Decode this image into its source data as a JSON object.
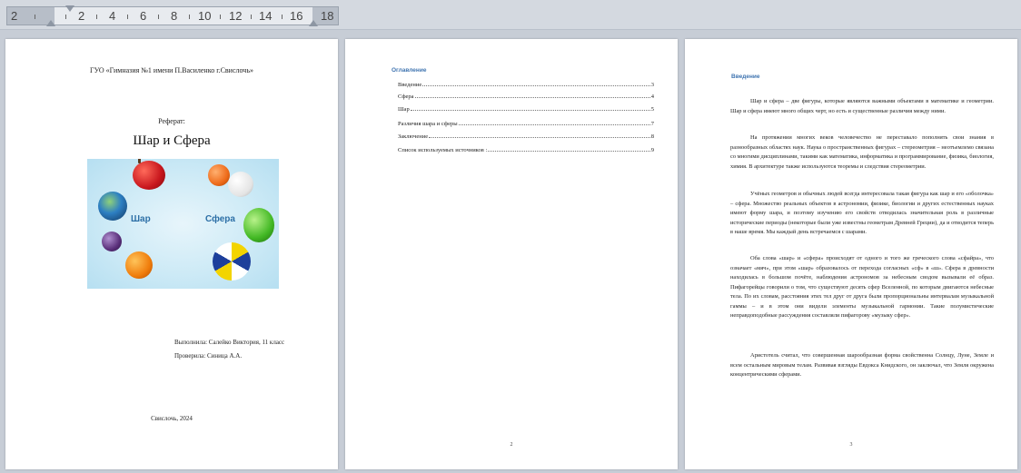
{
  "ruler": {
    "labels": [
      "2",
      "2",
      "4",
      "6",
      "8",
      "10",
      "12",
      "14",
      "16",
      "18"
    ]
  },
  "page1": {
    "header": "ГУО «Гимназия №1 имени П.Василенко г.Свислочь»",
    "ref_label": "Реферат:",
    "title": "Шар и Сфера",
    "cover_label_left": "Шар",
    "cover_label_right": "Сфера",
    "performed_by": "Выполнила: Салейко Виктория, 11 класс",
    "checked_by": "Проверила: Синица А.А.",
    "city_year": "Свислочь, 2024"
  },
  "page2": {
    "toc_title": "Оглавление",
    "toc": [
      {
        "title": "Введение",
        "page": "3"
      },
      {
        "title": "Сфера",
        "page": "4"
      },
      {
        "title": "Шар",
        "page": "5"
      },
      {
        "title": "Различия шара и сферы",
        "page": "7"
      },
      {
        "title": "Заключение",
        "page": "8"
      },
      {
        "title": "Список используемых источников :",
        "page": "9"
      }
    ],
    "page_number": "2"
  },
  "page3": {
    "heading": "Введение",
    "paragraphs": [
      "Шар и сфера – две фигуры, которые являются важными объектами в математике и геометрии. Шар и сфера имеют много общих черт, но есть и существенные различия между ними.",
      "На протяжении многих веков человечество не переставало пополнять свои знания в разнообразных областях наук. Наука о пространственных фигурах – стереометрия – неотъемлемо связана со многими дисциплинами, такими как математика, информатика и программирование, физика, биология, химия. В архитектуре также используются теоремы и следствия стереометрии.",
      "Учёных геометров и обычных людей всегда интересовала такая фигура как шар и его «оболочка» – сфера. Множество реальных объектов в астрономии, физике, биологии и других естественных науках имеют форму шара, и поэтому изучению его свойств отводилась значительная роль в различные исторические периоды (некоторые были уже известны геометрам Древней Греции), да и отводится теперь в наше время. Мы каждый день встречаемся с шарами.",
      "Оба слова «шар» и «сфера» происходят от одного и того же греческого слова «сфайра», что означает «мяч», при этом «шар» образовалось от перехода согласных «сф» в «ш». Сфера в древности находилась в большом почёте, наблюдения астрономов за небесным сводом вызывали её образ. Пифагорейцы говорили о том, что существуют десять сфер Вселенной, по которым двигаются небесные тела. По их словам, расстояния этих тел друг от друга были пропорциональны интервалам музыкальной гаммы – и в этом они видели элементы музыкальной гармонии. Такие полумистические неправдоподобные рассуждения составляли пифагорову «музыку сфер».",
      "Аристотель считал, что совершенная шарообразная форма свойственна Солнцу, Луне, Земле и всем остальным мировым телам. Развивая взгляды Евдокса Книдского, он заключал, что Земля окружена концентрическими сферами."
    ],
    "page_number": "3"
  },
  "colors": {
    "heading_blue": "#3f74b0",
    "cover_text": "#2c6fa6",
    "workspace": "#c7cdd6"
  }
}
